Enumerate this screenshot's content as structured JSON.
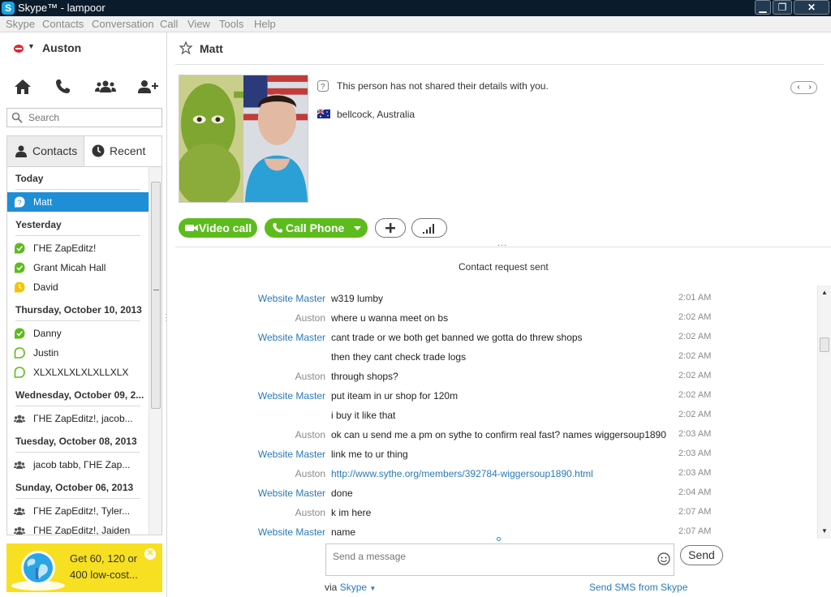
{
  "window": {
    "title": "Skype™ - lampoor",
    "logo_letter": "S",
    "minimize": "▁",
    "maximize": "❐",
    "close": "✕"
  },
  "menu": [
    "Skype",
    "Contacts",
    "Conversation",
    "Call",
    "View",
    "Tools",
    "Help"
  ],
  "profile": {
    "name": "Auston",
    "status_color": "#e0262e"
  },
  "search": {
    "placeholder": "Search"
  },
  "tabs": {
    "contacts": "Contacts",
    "recent": "Recent"
  },
  "recent_groups": [
    {
      "label": "Today",
      "items": [
        {
          "name": "Matt",
          "status": "unknown",
          "selected": true
        }
      ]
    },
    {
      "label": "Yesterday",
      "items": [
        {
          "name": "ΓΗΕ ZapEditz!",
          "status": "online"
        },
        {
          "name": "Grant Micah Hall",
          "status": "online"
        },
        {
          "name": "David",
          "status": "away"
        }
      ]
    },
    {
      "label": "Thursday, October 10, 2013",
      "items": [
        {
          "name": "Danny",
          "status": "online"
        },
        {
          "name": "Justin",
          "status": "offline-green"
        },
        {
          "name": "XLXLXLXLXLXLLXLX",
          "status": "offline-green"
        }
      ]
    },
    {
      "label": "Wednesday, October 09, 2...",
      "items": [
        {
          "name": "ΓΗΕ ZapEditz!, jacob...",
          "status": "group"
        }
      ]
    },
    {
      "label": "Tuesday, October 08, 2013",
      "items": [
        {
          "name": "jacob tabb, ΓΗΕ Zap...",
          "status": "group"
        }
      ]
    },
    {
      "label": "Sunday, October 06, 2013",
      "items": [
        {
          "name": "ΓΗΕ ZapEditz!, Tyler...",
          "status": "group"
        },
        {
          "name": "ΓΗΕ ZapEditz!, Jaiden",
          "status": "group"
        }
      ]
    }
  ],
  "ad": {
    "text": "Get 60, 120 or 400 low-cost...",
    "close": "✕"
  },
  "conversation": {
    "name": "Matt",
    "info_text": "This person has not shared their details with you.",
    "location": "bellcock, Australia",
    "pager_prev": "‹",
    "pager_next": "›",
    "video_call": "Video call",
    "call_phone": "Call Phone",
    "more": "...",
    "request_note": "Contact request sent"
  },
  "messages": [
    {
      "sender": "Website Master",
      "text": "w319 lumby",
      "time": "2:01 AM"
    },
    {
      "sender": "Auston",
      "text": "where u wanna meet on bs",
      "time": "2:02 AM"
    },
    {
      "sender": "Website Master",
      "text": "cant trade or we both get banned we gotta do threw shops",
      "time": "2:02 AM"
    },
    {
      "sender": "",
      "text": "then they cant check trade logs",
      "time": "2:02 AM"
    },
    {
      "sender": "Auston",
      "text": "through shops?",
      "time": "2:02 AM"
    },
    {
      "sender": "Website Master",
      "text": "put iteam in ur shop for 120m",
      "time": "2:02 AM"
    },
    {
      "sender": "",
      "text": "i buy it like that",
      "time": "2:02 AM"
    },
    {
      "sender": "Auston",
      "text": "ok can u send me a pm on sythe to confirm real fast? names wiggersoup1890",
      "time": "2:03 AM"
    },
    {
      "sender": "Website Master",
      "text": "link me to ur thing",
      "time": "2:03 AM"
    },
    {
      "sender": "Auston",
      "text": "http://www.sythe.org/members/392784-wiggersoup1890.html",
      "time": "2:03 AM",
      "link": true
    },
    {
      "sender": "Website Master",
      "text": "done",
      "time": "2:04 AM"
    },
    {
      "sender": "Auston",
      "text": "k im here",
      "time": "2:07 AM"
    },
    {
      "sender": "Website Master",
      "text": "name",
      "time": "2:07 AM"
    }
  ],
  "compose": {
    "placeholder": "Send a message",
    "send": "Send",
    "via_prefix": "via",
    "via_value": "Skype",
    "sms": "Send SMS from Skype"
  },
  "colors": {
    "accent_blue": "#1e8fd6",
    "call_green": "#5dbb1e",
    "ad_yellow": "#f7df21",
    "link_blue": "#2a7ab8"
  }
}
